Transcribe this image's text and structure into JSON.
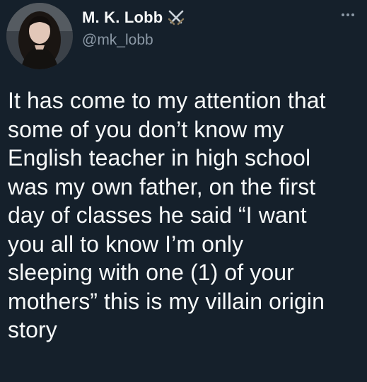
{
  "author": {
    "display_name": "M. K. Lobb",
    "name_emoji": "crossed-swords-icon",
    "handle": "@mk_lobb"
  },
  "tweet": {
    "text": "It has come to my attention that\nsome of you don’t know my\nEnglish teacher in high school\nwas my own father, on the first\nday of classes he said “I want\nyou all to know I’m only\nsleeping with one (1) of your\nmothers” this is my villain origin\nstory"
  },
  "colors": {
    "background": "#15202b",
    "text_primary": "#f7f9f9",
    "text_secondary": "#8b98a5"
  }
}
